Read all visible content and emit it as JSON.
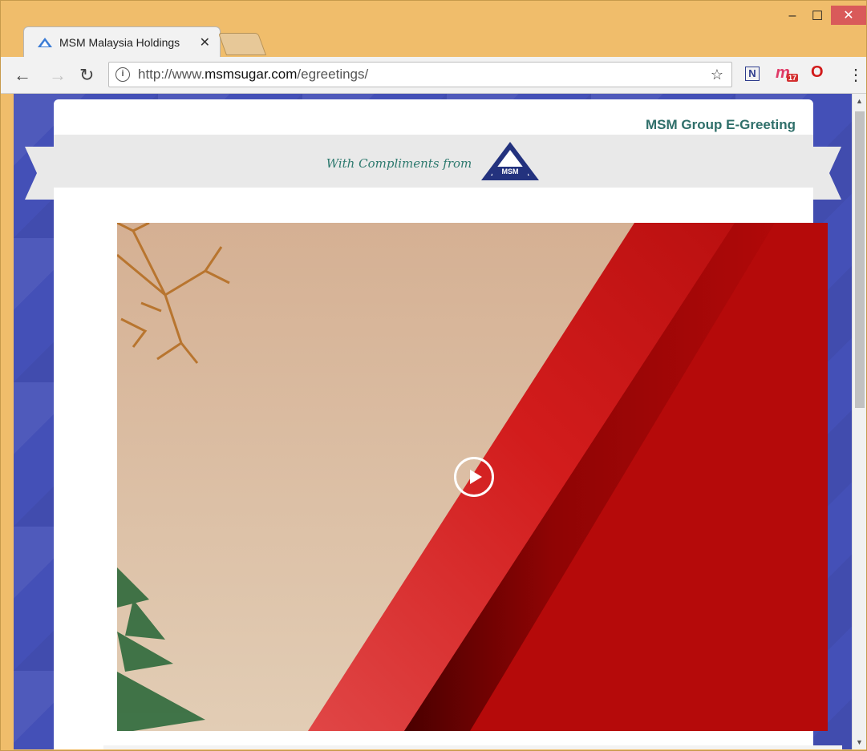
{
  "browser": {
    "tab": {
      "title": "MSM Malaysia Holdings",
      "close_label": "✕",
      "icon": "msm-triangle-favicon"
    },
    "window_controls": {
      "minimize": "–",
      "maximize": "☐",
      "close": "✕"
    },
    "toolbar": {
      "back_glyph": "←",
      "forward_glyph": "→",
      "reload_glyph": "↻",
      "info_glyph": "i",
      "url_prefix": "http://www.",
      "url_domain": "msmsugar.com",
      "url_path": "/egreetings/",
      "star_glyph": "☆",
      "extensions": [
        {
          "name": "n-extension-icon",
          "glyph": "N"
        },
        {
          "name": "m-extension-icon",
          "glyph": "m",
          "badge": "17"
        },
        {
          "name": "opera-icon",
          "glyph": "O"
        }
      ],
      "menu_glyph": "⋮"
    }
  },
  "page": {
    "brand_title": "MSM Group E-Greeting",
    "compliments_text": "With Compliments from",
    "logo_text": "MSM",
    "video": {
      "play_icon": "play-icon"
    }
  },
  "colors": {
    "page_background": "#4450b7",
    "brand_title": "#2f6f6a",
    "compliments_text": "#2e7a6f",
    "video_red": "#b80a0a",
    "video_beige": "#d8b799",
    "logo_blue": "#23327e"
  }
}
